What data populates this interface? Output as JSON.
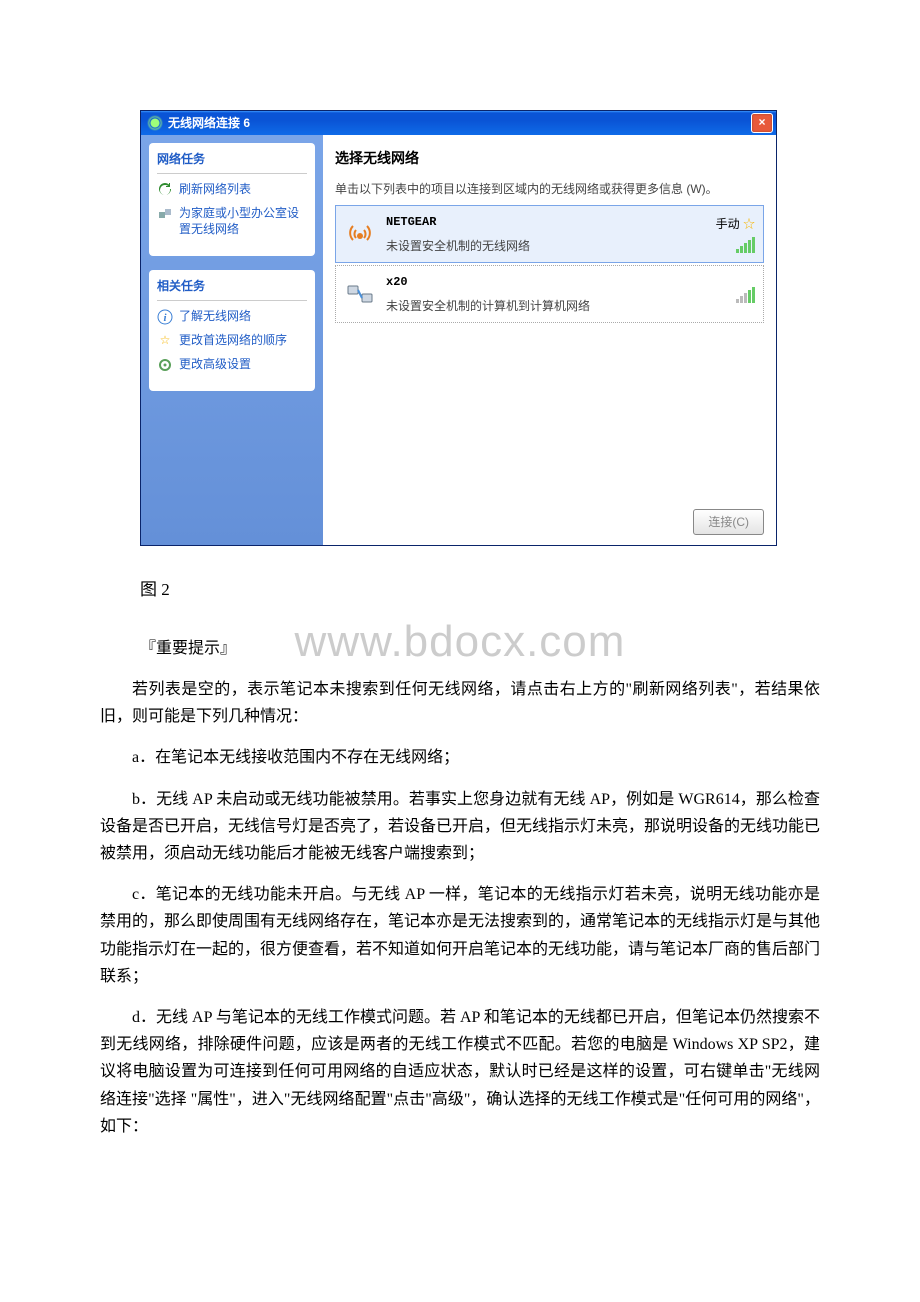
{
  "window": {
    "title": "无线网络连接 6",
    "main_heading": "选择无线网络",
    "instruction": "单击以下列表中的项目以连接到区域内的无线网络或获得更多信息 (W)。",
    "connect_button": "连接(C)",
    "sidebar": {
      "network_tasks_title": "网络任务",
      "refresh": "刷新网络列表",
      "setup": "为家庭或小型办公室设置无线网络",
      "related_tasks_title": "相关任务",
      "learn": "了解无线网络",
      "order": "更改首选网络的顺序",
      "advanced": "更改高级设置"
    },
    "networks": [
      {
        "ssid": "NETGEAR",
        "desc": "未设置安全机制的无线网络",
        "badge": "手动"
      },
      {
        "ssid": "x20",
        "desc": "未设置安全机制的计算机到计算机网络"
      }
    ]
  },
  "caption": "图 2",
  "watermark": "www.bdocx.com",
  "prompt_title": "『重要提示』",
  "p_intro": "若列表是空的，表示笔记本未搜索到任何无线网络，请点击右上方的\"刷新网络列表\"，若结果依旧，则可能是下列几种情况：",
  "p_a": "a．在笔记本无线接收范围内不存在无线网络；",
  "p_b": "b．无线 AP 未启动或无线功能被禁用。若事实上您身边就有无线 AP，例如是 WGR614，那么检查设备是否已开启，无线信号灯是否亮了，若设备已开启，但无线指示灯未亮，那说明设备的无线功能已被禁用，须启动无线功能后才能被无线客户端搜索到；",
  "p_c": "c．笔记本的无线功能未开启。与无线 AP 一样，笔记本的无线指示灯若未亮，说明无线功能亦是禁用的，那么即使周围有无线网络存在，笔记本亦是无法搜索到的，通常笔记本的无线指示灯是与其他功能指示灯在一起的，很方便查看，若不知道如何开启笔记本的无线功能，请与笔记本厂商的售后部门联系；",
  "p_d": "d．无线 AP 与笔记本的无线工作模式问题。若 AP 和笔记本的无线都已开启，但笔记本仍然搜索不到无线网络，排除硬件问题，应该是两者的无线工作模式不匹配。若您的电脑是 Windows XP SP2，建议将电脑设置为可连接到任何可用网络的自适应状态，默认时已经是这样的设置，可右键单击\"无线网络连接\"选择 \"属性\"，进入\"无线网络配置\"点击\"高级\"，确认选择的无线工作模式是\"任何可用的网络\"，如下："
}
